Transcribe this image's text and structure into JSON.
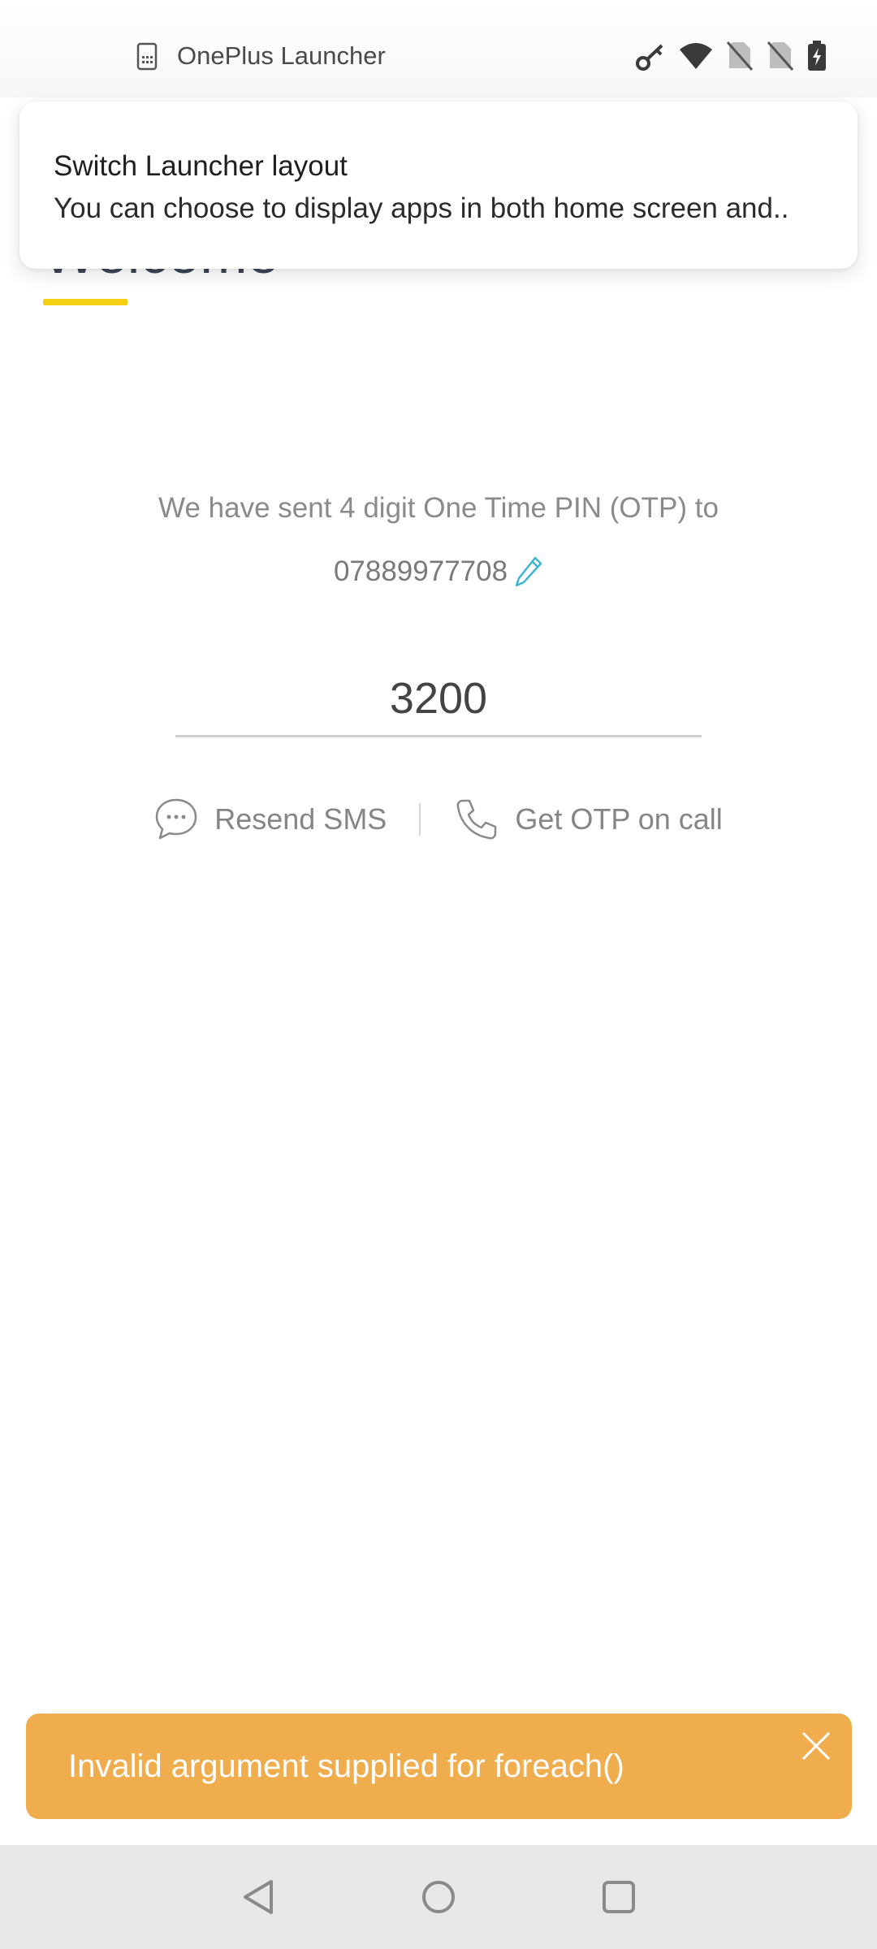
{
  "status_bar": {
    "app_name": "OnePlus Launcher",
    "icons": [
      "sim-card-icon",
      "key-icon",
      "wifi-icon",
      "no-sim-icon",
      "no-sim-icon",
      "battery-charging-icon"
    ]
  },
  "notification": {
    "title": "Switch Launcher layout",
    "body": "You can choose to display apps in both home screen and.."
  },
  "header": {
    "title": "Welcome",
    "accent_color": "#f5cf13"
  },
  "otp": {
    "message": "We have sent 4 digit One Time PIN (OTP) to",
    "phone_number": "07889977708",
    "input_value": "3200",
    "edit_icon": "pencil-icon",
    "edit_icon_color": "#3fb5d6"
  },
  "actions": {
    "resend_label": "Resend SMS",
    "resend_icon": "chat-bubble-icon",
    "call_label": "Get OTP on call",
    "call_icon": "phone-icon"
  },
  "error_toast": {
    "message": "Invalid argument supplied for foreach()",
    "background_color": "#f0ad4e",
    "close_icon": "close-icon"
  },
  "nav_bar": {
    "buttons": [
      "back-icon",
      "home-icon",
      "recents-icon"
    ]
  }
}
